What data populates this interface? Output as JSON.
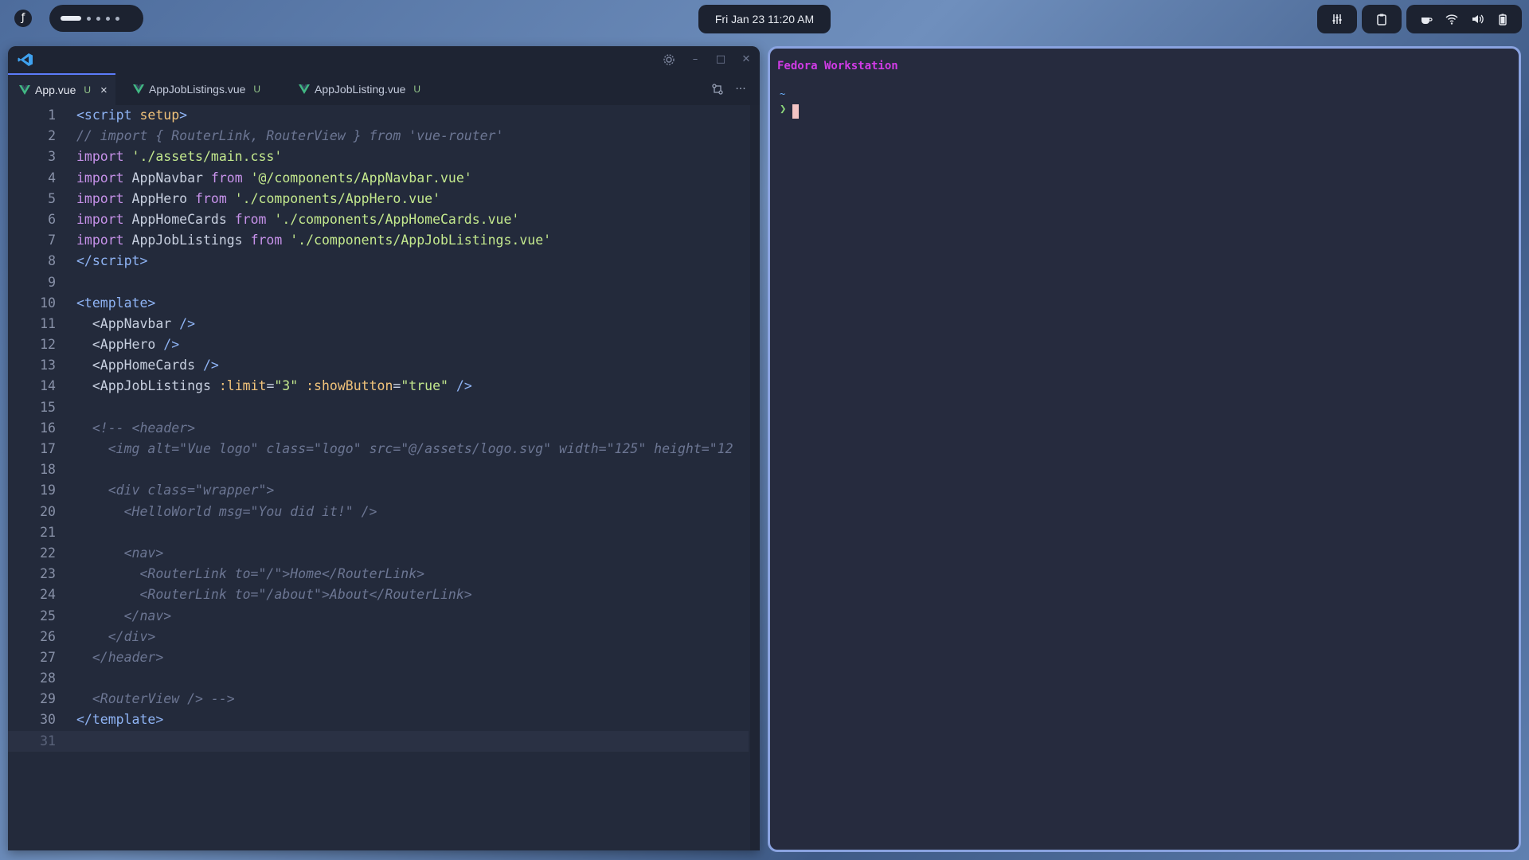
{
  "topbar": {
    "clock": "Fri Jan 23  11:20 AM"
  },
  "vscode": {
    "tabs": [
      {
        "label": "App.vue",
        "status": "U",
        "active": true
      },
      {
        "label": "AppJobListings.vue",
        "status": "U",
        "active": false
      },
      {
        "label": "AppJobListing.vue",
        "status": "U",
        "active": false
      }
    ],
    "close_glyph": "×",
    "more_glyph": "···",
    "code": [
      {
        "n": "1",
        "html": "<span class='tag'>&lt;script</span> <span class='attr'>setup</span><span class='tag'>&gt;</span>"
      },
      {
        "n": "2",
        "html": "<span class='cmt'>// import { RouterLink, RouterView } from 'vue-router'</span>"
      },
      {
        "n": "3",
        "html": "<span class='kw'>import</span> <span class='str'>'./assets/main.css'</span>"
      },
      {
        "n": "4",
        "html": "<span class='kw'>import</span> <span class='plain'>AppNavbar</span> <span class='kw'>from</span> <span class='str'>'@/components/AppNavbar.vue'</span>"
      },
      {
        "n": "5",
        "html": "<span class='kw'>import</span> <span class='plain'>AppHero</span> <span class='kw'>from</span> <span class='str'>'./components/AppHero.vue'</span>"
      },
      {
        "n": "6",
        "html": "<span class='kw'>import</span> <span class='plain'>AppHomeCards</span> <span class='kw'>from</span> <span class='str'>'./components/AppHomeCards.vue'</span>"
      },
      {
        "n": "7",
        "html": "<span class='kw'>import</span> <span class='plain'>AppJobListings</span> <span class='kw'>from</span> <span class='str'>'./components/AppJobListings.vue'</span>"
      },
      {
        "n": "8",
        "html": "<span class='tag'>&lt;/script&gt;</span>"
      },
      {
        "n": "9",
        "html": ""
      },
      {
        "n": "10",
        "html": "<span class='tag'>&lt;template&gt;</span>"
      },
      {
        "n": "11",
        "html": "  <span class='plain'>&lt;AppNavbar</span> <span class='tag'>/&gt;</span>"
      },
      {
        "n": "12",
        "html": "  <span class='plain'>&lt;AppHero</span> <span class='tag'>/&gt;</span>"
      },
      {
        "n": "13",
        "html": "  <span class='plain'>&lt;AppHomeCards</span> <span class='tag'>/&gt;</span>"
      },
      {
        "n": "14",
        "html": "  <span class='plain'>&lt;AppJobListings</span> <span class='attr'>:limit</span><span class='plain'>=</span><span class='str'>\"3\"</span> <span class='attr'>:showButton</span><span class='plain'>=</span><span class='str'>\"true\"</span> <span class='tag'>/&gt;</span>"
      },
      {
        "n": "15",
        "html": ""
      },
      {
        "n": "16",
        "html": "  <span class='cmt'>&lt;!-- &lt;header&gt;</span>"
      },
      {
        "n": "17",
        "html": "    <span class='cmt'>&lt;img alt=\"Vue logo\" class=\"logo\" src=\"@/assets/logo.svg\" width=\"125\" height=\"12</span>"
      },
      {
        "n": "18",
        "html": ""
      },
      {
        "n": "19",
        "html": "    <span class='cmt'>&lt;div class=\"wrapper\"&gt;</span>"
      },
      {
        "n": "20",
        "html": "      <span class='cmt'>&lt;HelloWorld msg=\"You did it!\" /&gt;</span>"
      },
      {
        "n": "21",
        "html": ""
      },
      {
        "n": "22",
        "html": "      <span class='cmt'>&lt;nav&gt;</span>"
      },
      {
        "n": "23",
        "html": "        <span class='cmt'>&lt;RouterLink to=\"/\"&gt;Home&lt;/RouterLink&gt;</span>"
      },
      {
        "n": "24",
        "html": "        <span class='cmt'>&lt;RouterLink to=\"/about\"&gt;About&lt;/RouterLink&gt;</span>"
      },
      {
        "n": "25",
        "html": "      <span class='cmt'>&lt;/nav&gt;</span>"
      },
      {
        "n": "26",
        "html": "    <span class='cmt'>&lt;/div&gt;</span>"
      },
      {
        "n": "27",
        "html": "  <span class='cmt'>&lt;/header&gt;</span>"
      },
      {
        "n": "28",
        "html": ""
      },
      {
        "n": "29",
        "html": "  <span class='cmt'>&lt;RouterView /&gt; --&gt;</span>"
      },
      {
        "n": "30",
        "html": "<span class='tag'>&lt;/template&gt;</span>"
      },
      {
        "n": "31",
        "html": ""
      }
    ],
    "current_line": "31"
  },
  "terminal": {
    "title": "Fedora Workstation",
    "cwd": "~",
    "prompt": "❯"
  },
  "colors": {
    "accent": "#5c7cfa",
    "terminal_title": "#d13be6",
    "prompt": "#8bd57a",
    "editor_bg": "#232a3b"
  }
}
